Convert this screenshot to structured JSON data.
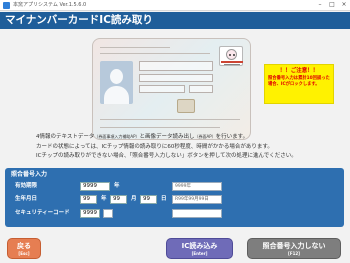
{
  "window": {
    "title": "本窯アプリシステム Ver.1.5.6.0",
    "minimize_icon": "minimize-icon",
    "maximize_icon": "maximize-icon",
    "close_icon": "close-icon"
  },
  "header": {
    "title": "マイナンバーカードIC読み取り"
  },
  "caution": {
    "title": "！！ご注意！！",
    "body": "照合番号入力は累計10回誤った場合、ICがロックします。"
  },
  "description": {
    "line1_a": "4情報のテキストデータ",
    "line1_b": "（券面事項入力補助AP）",
    "line1_c": "と画像データ読み出し",
    "line1_d": "（券面AP）",
    "line1_e": "を行います。",
    "line2": "カードの状態によっては、ICチップ情報の読み取りに60秒程度、時間がかかる場合があります。",
    "line3": "ICチップの読み取りができない場合、「照合番号入力しない」ボタンを押して次の処理に進んでください。"
  },
  "form": {
    "title": "照合番号入力",
    "expiry": {
      "label": "有効期限",
      "year_value": "9999",
      "year_unit": "年",
      "hint": "9999年"
    },
    "birth": {
      "label": "生年月日",
      "year_value": "99",
      "year_unit": "年",
      "month_value": "99",
      "month_unit": "月",
      "day_value": "99",
      "day_unit": "日",
      "hint": "R99年99月99日"
    },
    "security": {
      "label": "セキュリティーコード",
      "value": "9999"
    }
  },
  "buttons": {
    "back": {
      "label": "戻る",
      "key": "[Esc]"
    },
    "ic_read": {
      "label": "IC読み込み",
      "key": "[Enter]"
    },
    "no_input": {
      "label": "照合番号入力しない",
      "key": "[F12]"
    }
  },
  "colors": {
    "header": "#1f5e9a",
    "panel": "#2e6fb0",
    "caution_bg": "#fff200",
    "caution_text": "#e00000",
    "back_button": "#e67e52",
    "ic_button": "#6f6bb8",
    "no_input_button": "#7e7e7e"
  }
}
